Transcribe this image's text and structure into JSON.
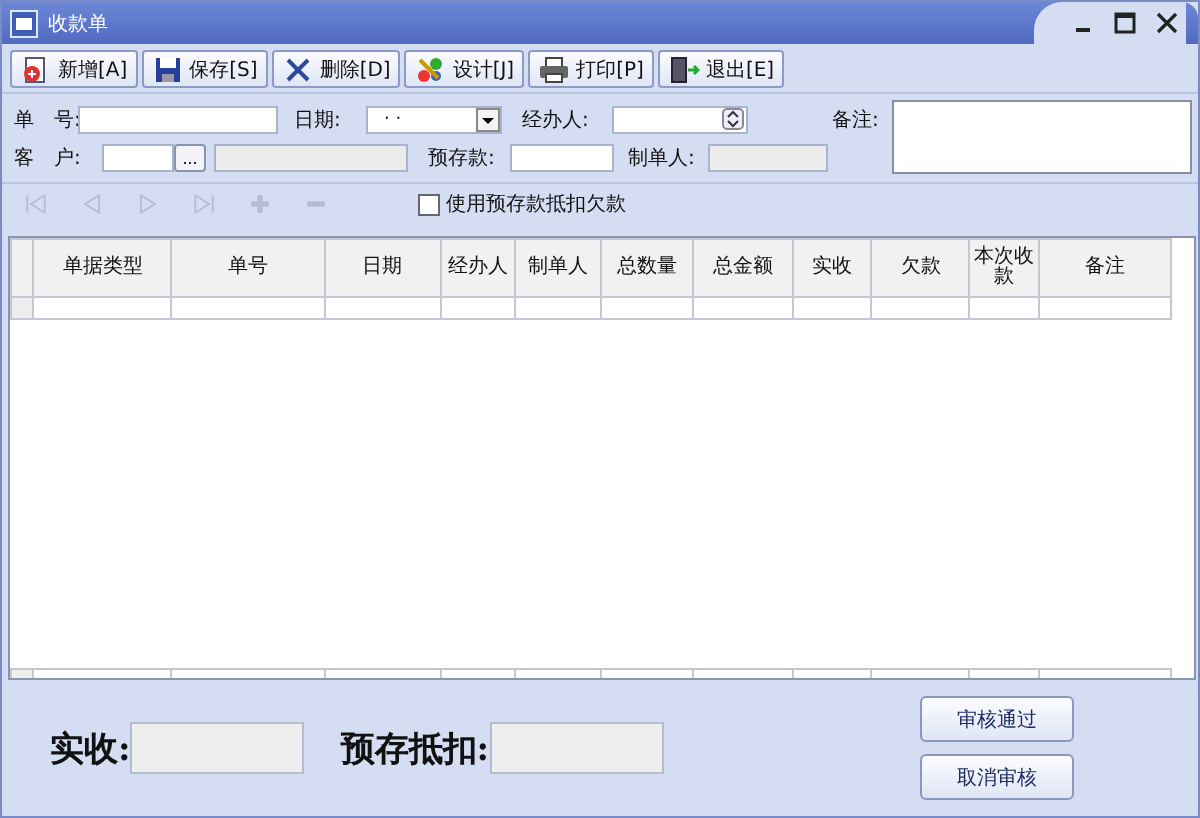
{
  "window": {
    "title": "收款单"
  },
  "toolbar": [
    {
      "label": "新增[A]"
    },
    {
      "label": "保存[S]"
    },
    {
      "label": "删除[D]"
    },
    {
      "label": "设计[J]"
    },
    {
      "label": "打印[P]"
    },
    {
      "label": "退出[E]"
    }
  ],
  "form": {
    "number_label": "单　号:",
    "date_label": "日期:",
    "date_value": "· ·",
    "handler_label": "经办人:",
    "remark_label": "备注:",
    "customer_label": "客　户:",
    "customer_button": "...",
    "prepaid_label": "预存款:",
    "maker_label": "制单人:"
  },
  "navigator": [
    {
      "disabled": true
    },
    {
      "disabled": true
    },
    {
      "disabled": true
    },
    {
      "disabled": true
    },
    {
      "disabled": true
    },
    {
      "disabled": true
    }
  ],
  "use_prepaid": {
    "label": "使用预存款抵扣欠款",
    "checked": false
  },
  "table": {
    "columns": [
      "单据类型",
      "单号",
      "日期",
      "经办人",
      "制单人",
      "总数量",
      "总金额",
      "实收",
      "欠款",
      "本次收款",
      "备注"
    ]
  },
  "summary": [
    {
      "label": "实收:"
    },
    {
      "label": "预存抵扣:"
    }
  ],
  "buttons": [
    "审核通过",
    "取消审核"
  ]
}
